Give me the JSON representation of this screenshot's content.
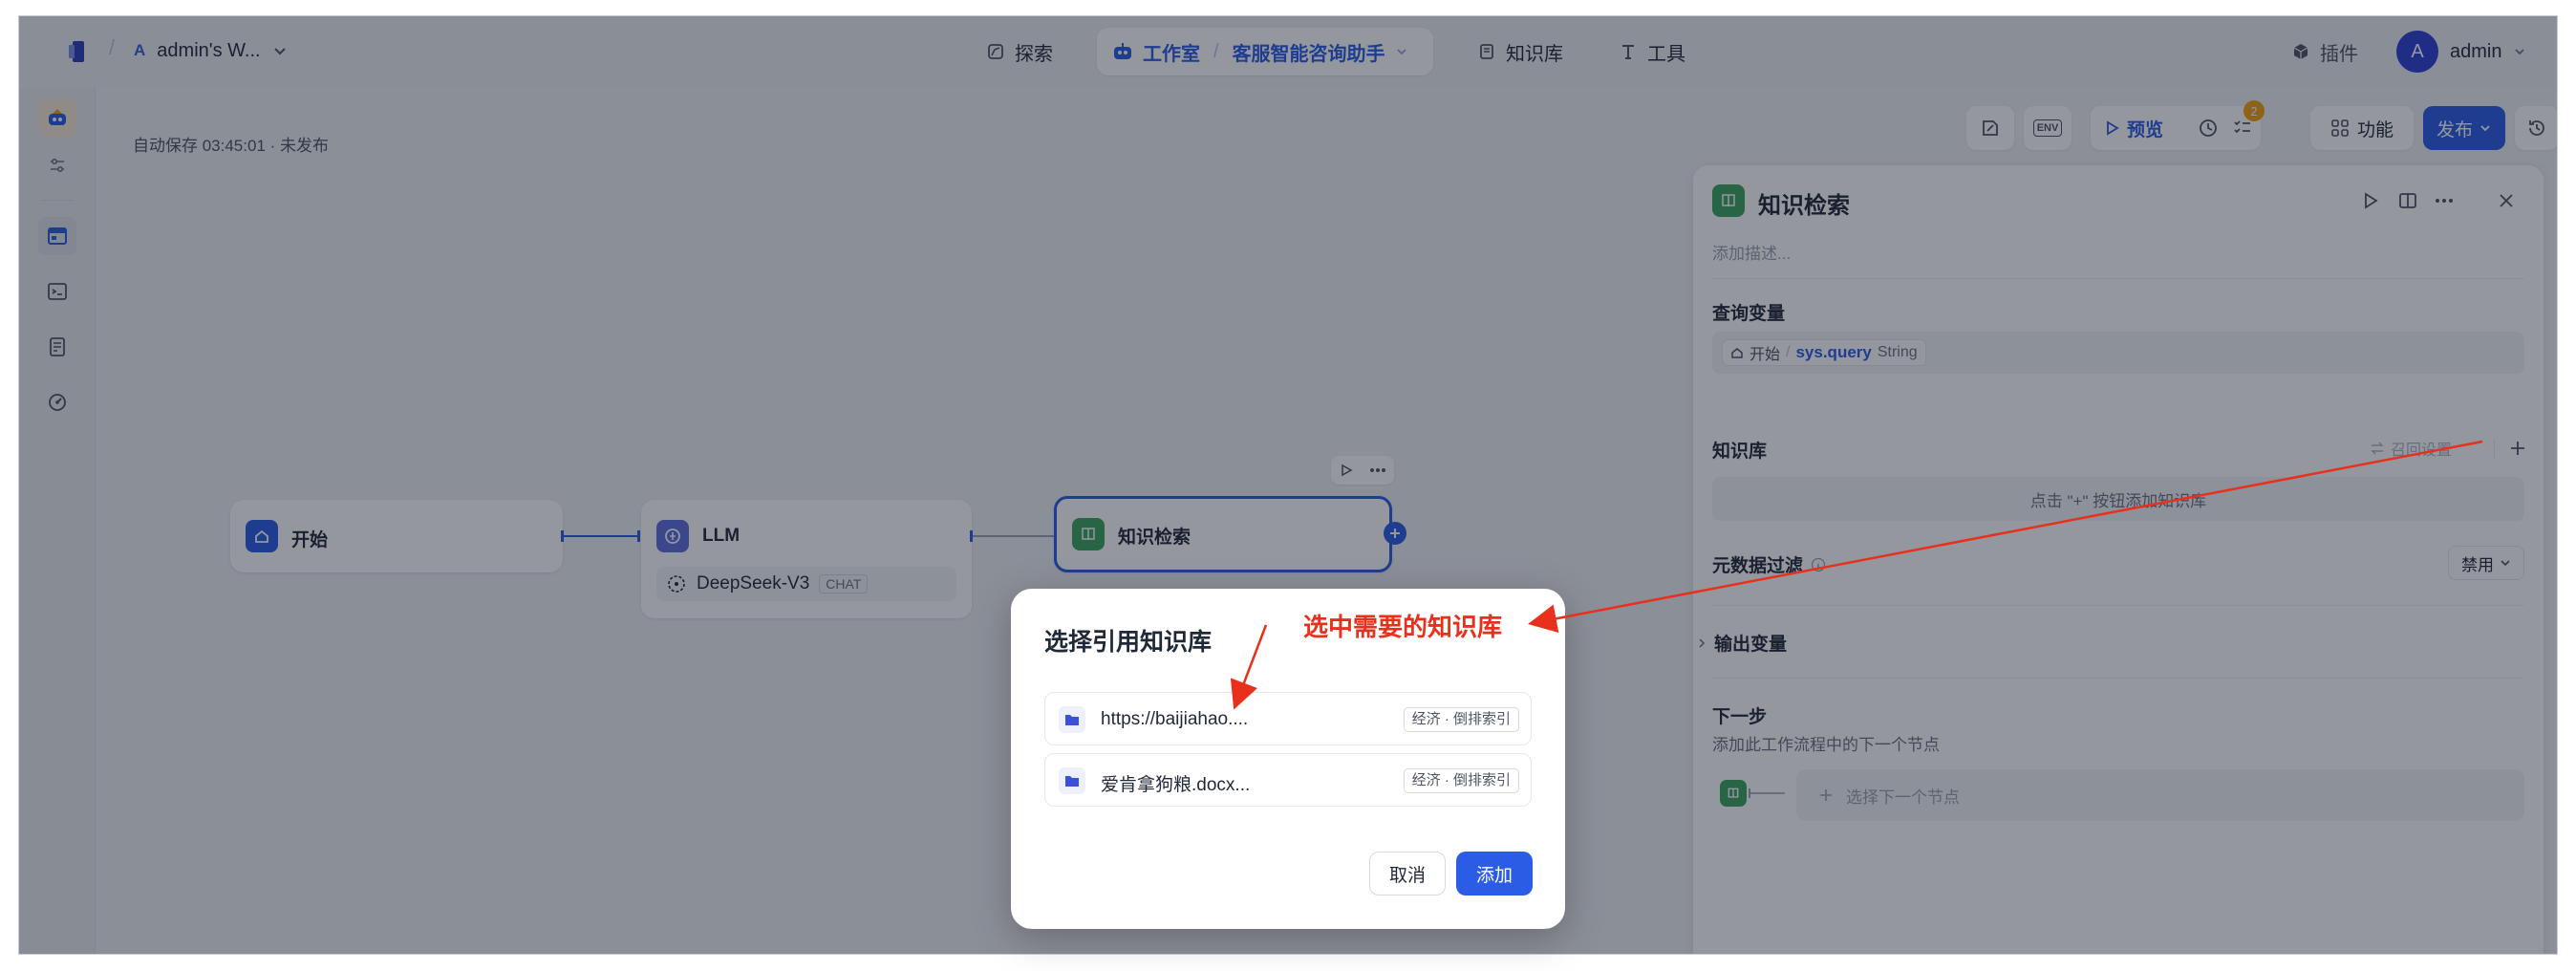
{
  "header": {
    "workspace_initial": "A",
    "workspace_name": "admin's W...",
    "nav": {
      "explore": "探索",
      "studio": "工作室",
      "app_name": "客服智能咨询助手",
      "knowledge": "知识库",
      "tools": "工具"
    },
    "plugins": "插件",
    "user_initial": "A",
    "user_name": "admin"
  },
  "toolbar": {
    "autosave": "自动保存 03:45:01 · 未发布",
    "env": "ENV",
    "preview": "预览",
    "checklist_badge": "2",
    "features": "功能",
    "publish": "发布"
  },
  "nodes": {
    "start": {
      "title": "开始"
    },
    "llm": {
      "title": "LLM",
      "model": "DeepSeek-V3",
      "model_tag": "CHAT"
    },
    "retrieval": {
      "title": "知识检索"
    }
  },
  "panel": {
    "title": "知识检索",
    "desc_placeholder": "添加描述...",
    "query_var_label": "查询变量",
    "query_var": {
      "node": "开始",
      "name": "sys.query",
      "type": "String"
    },
    "kb_label": "知识库",
    "recall_settings": "召回设置",
    "kb_empty_hint": "点击 \"+\" 按钮添加知识库",
    "metadata_label": "元数据过滤",
    "metadata_value": "禁用",
    "output_vars": "输出变量",
    "next_step": "下一步",
    "next_step_desc": "添加此工作流程中的下一个节点",
    "select_next": "选择下一个节点"
  },
  "dialog": {
    "title": "选择引用知识库",
    "items": [
      {
        "name": "https://baijiahao....",
        "tag": "经济 · 倒排索引"
      },
      {
        "name": "爱肯拿狗粮.docx...",
        "tag": "经济 · 倒排索引"
      }
    ],
    "cancel": "取消",
    "add": "添加"
  },
  "annotation": {
    "text": "选中需要的知识库",
    "color": "#e8301c"
  },
  "colors": {
    "primary": "#2b5ce6",
    "green": "#3aa55d",
    "badge": "#f59e0b"
  }
}
